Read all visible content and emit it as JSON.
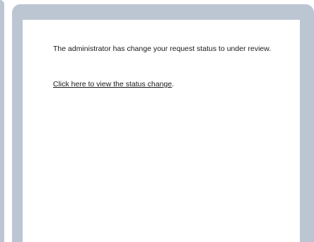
{
  "notification": {
    "message": "The administrator has change your request status to under review.",
    "link_text": "Click here to view the status change",
    "link_suffix": "."
  },
  "colors": {
    "panel_background": "#bcc6d2",
    "content_background": "#ffffff",
    "text": "#1a1a1a"
  }
}
